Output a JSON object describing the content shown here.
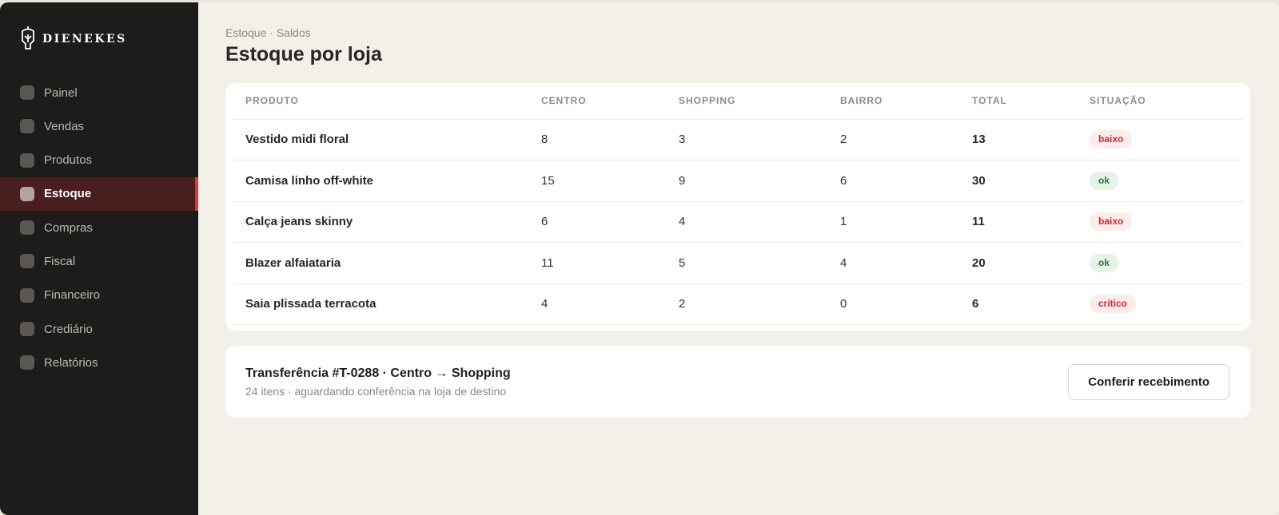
{
  "brand": {
    "name": "DIENEKES",
    "icon": "helmet-logo-icon"
  },
  "sidebar": {
    "items": [
      {
        "label": "Painel",
        "active": false
      },
      {
        "label": "Vendas",
        "active": false
      },
      {
        "label": "Produtos",
        "active": false
      },
      {
        "label": "Estoque",
        "active": true
      },
      {
        "label": "Compras",
        "active": false
      },
      {
        "label": "Fiscal",
        "active": false
      },
      {
        "label": "Financeiro",
        "active": false
      },
      {
        "label": "Crediário",
        "active": false
      },
      {
        "label": "Relatórios",
        "active": false
      }
    ]
  },
  "header": {
    "breadcrumb": "Estoque · Saldos",
    "title": "Estoque por loja"
  },
  "table": {
    "columns": [
      "PRODUTO",
      "CENTRO",
      "SHOPPING",
      "BAIRRO",
      "TOTAL",
      "SITUAÇÃO"
    ],
    "rows": [
      {
        "produto": "Vestido midi floral",
        "centro": "8",
        "shopping": "3",
        "bairro": "2",
        "total": "13",
        "situacao": "baixo",
        "status_color": "red"
      },
      {
        "produto": "Camisa linho off-white",
        "centro": "15",
        "shopping": "9",
        "bairro": "6",
        "total": "30",
        "situacao": "ok",
        "status_color": "green"
      },
      {
        "produto": "Calça jeans skinny",
        "centro": "6",
        "shopping": "4",
        "bairro": "1",
        "total": "11",
        "situacao": "baixo",
        "status_color": "red"
      },
      {
        "produto": "Blazer alfaiataria",
        "centro": "11",
        "shopping": "5",
        "bairro": "4",
        "total": "20",
        "situacao": "ok",
        "status_color": "green"
      },
      {
        "produto": "Saia plissada terracota",
        "centro": "4",
        "shopping": "2",
        "bairro": "0",
        "total": "6",
        "situacao": "crítico",
        "status_color": "red"
      }
    ]
  },
  "transfer": {
    "title": "Transferência #T-0288 · Centro → Shopping",
    "subtitle": "24 itens · aguardando conferência na loja de destino",
    "button_label": "Conferir recebimento"
  },
  "colors": {
    "accent": "#e0363b",
    "sidebar_bg": "#1e1c1a",
    "active_bg": "#4a1d1e",
    "page_bg": "#f3f0ea"
  }
}
